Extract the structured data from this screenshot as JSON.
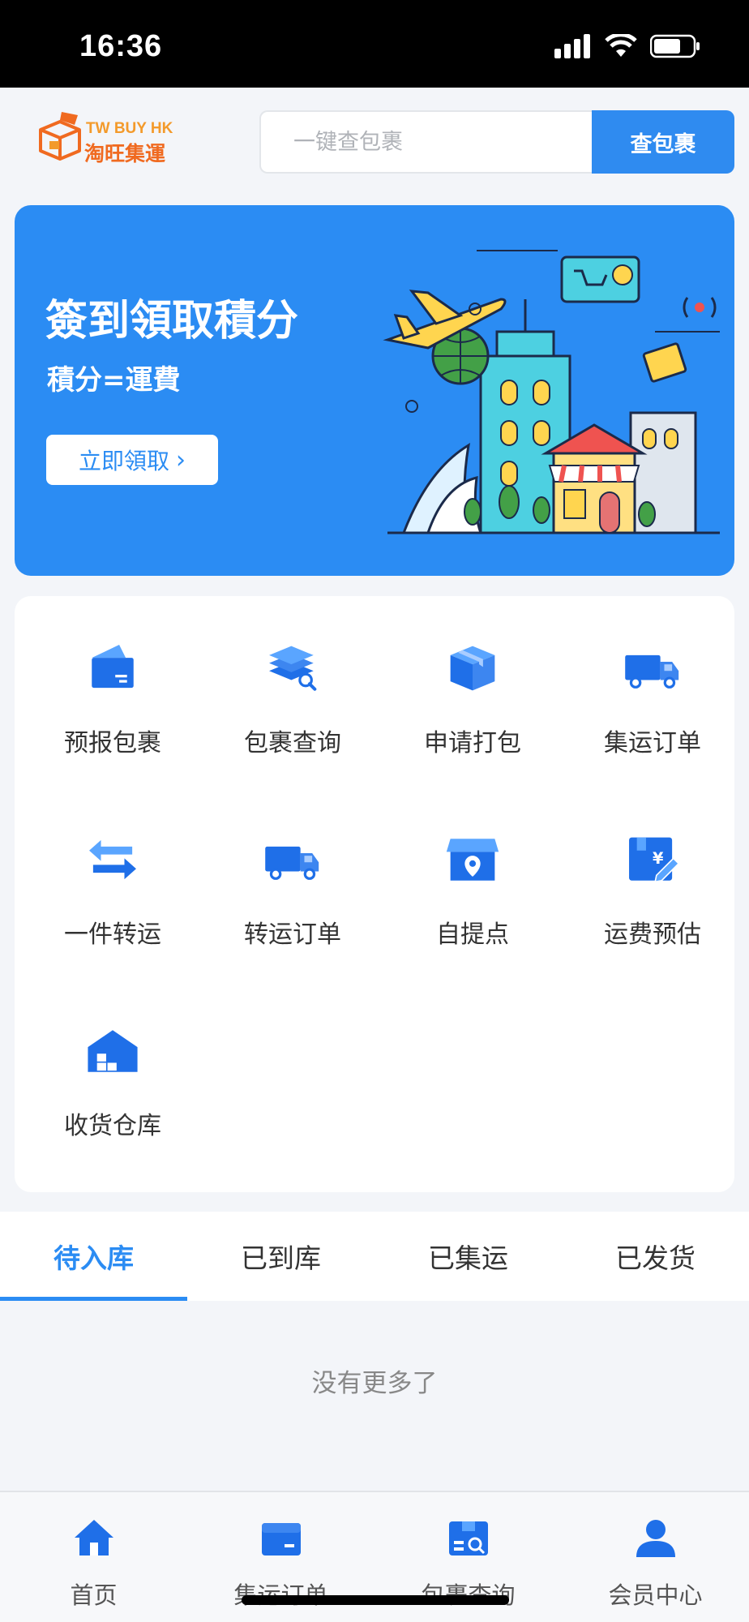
{
  "status_bar": {
    "time": "16:36"
  },
  "header": {
    "logo_en": "TW BUY HK",
    "logo_cn": "淘旺集運",
    "search_placeholder": "一键查包裹",
    "search_button": "查包裹"
  },
  "banner": {
    "title": "簽到領取積分",
    "subtitle": "積分=運費",
    "button": "立即領取",
    "button_chevron": "›"
  },
  "menu": [
    {
      "label": "预报包裹",
      "icon": "parcel-forecast-icon"
    },
    {
      "label": "包裹查询",
      "icon": "parcel-search-icon"
    },
    {
      "label": "申请打包",
      "icon": "box-pack-icon"
    },
    {
      "label": "集运订单",
      "icon": "truck-icon"
    },
    {
      "label": "一件转运",
      "icon": "transfer-arrows-icon"
    },
    {
      "label": "转运订单",
      "icon": "truck-icon"
    },
    {
      "label": "自提点",
      "icon": "store-pickup-icon"
    },
    {
      "label": "运费预估",
      "icon": "fee-estimate-icon"
    },
    {
      "label": "收货仓库",
      "icon": "warehouse-icon"
    }
  ],
  "tabs": [
    {
      "label": "待入库",
      "active": true
    },
    {
      "label": "已到库",
      "active": false
    },
    {
      "label": "已集运",
      "active": false
    },
    {
      "label": "已发货",
      "active": false
    }
  ],
  "empty_text": "没有更多了",
  "bottom_nav": [
    {
      "label": "首页",
      "icon": "home-icon"
    },
    {
      "label": "集运订单",
      "icon": "order-icon"
    },
    {
      "label": "包裹查询",
      "icon": "parcel-search-icon"
    },
    {
      "label": "会员中心",
      "icon": "user-icon"
    }
  ],
  "colors": {
    "primary": "#2b8cf3",
    "logo_orange": "#f06a20"
  }
}
